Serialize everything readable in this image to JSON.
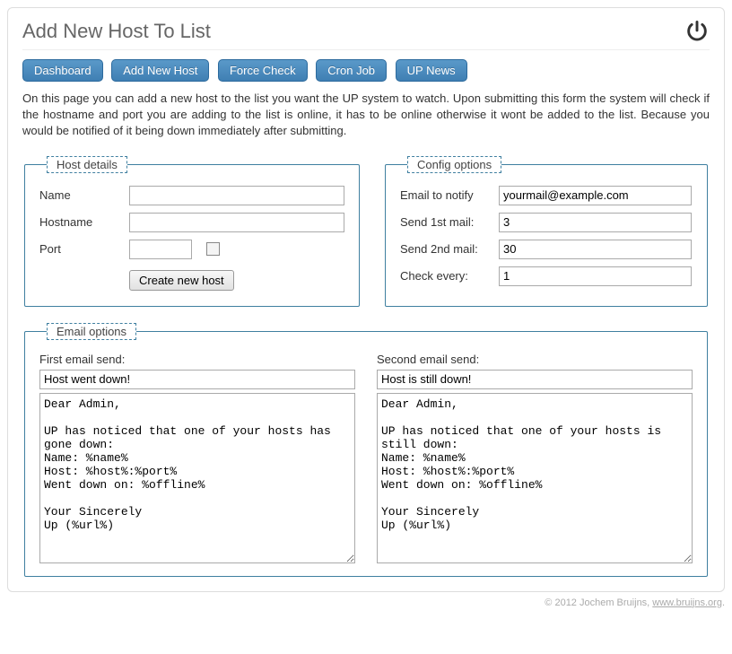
{
  "header": {
    "title": "Add New Host To List"
  },
  "nav": {
    "items": [
      "Dashboard",
      "Add New Host",
      "Force Check",
      "Cron Job",
      "UP News"
    ]
  },
  "intro": "On this page you can add a new host to the list you want the UP system to watch. Upon submitting this form the system will check if the hostname and port you are adding to the list is online, it has to be online otherwise it wont be added to the list. Because you would be notified of it being down immediately after submitting.",
  "host_details": {
    "legend": "Host details",
    "name_label": "Name",
    "name_value": "",
    "hostname_label": "Hostname",
    "hostname_value": "",
    "port_label": "Port",
    "port_value": "",
    "submit_label": "Create new host"
  },
  "config": {
    "legend": "Config options",
    "email_label": "Email to notify",
    "email_value": "yourmail@example.com",
    "first_label": "Send 1st mail:",
    "first_value": "3",
    "second_label": "Send 2nd mail:",
    "second_value": "30",
    "check_label": "Check every:",
    "check_value": "1"
  },
  "email": {
    "legend": "Email options",
    "first": {
      "label": "First email send:",
      "subject": "Host went down!",
      "body": "Dear Admin,\n\nUP has noticed that one of your hosts has gone down:\nName: %name%\nHost: %host%:%port%\nWent down on: %offline%\n\nYour Sincerely\nUp (%url%)"
    },
    "second": {
      "label": "Second email send:",
      "subject": "Host is still down!",
      "body": "Dear Admin,\n\nUP has noticed that one of your hosts is still down:\nName: %name%\nHost: %host%:%port%\nWent down on: %offline%\n\nYour Sincerely\nUp (%url%)"
    }
  },
  "footer": {
    "text_prefix": "© 2012 Jochem Bruijns, ",
    "link_text": "www.bruijns.org",
    "text_suffix": "."
  }
}
